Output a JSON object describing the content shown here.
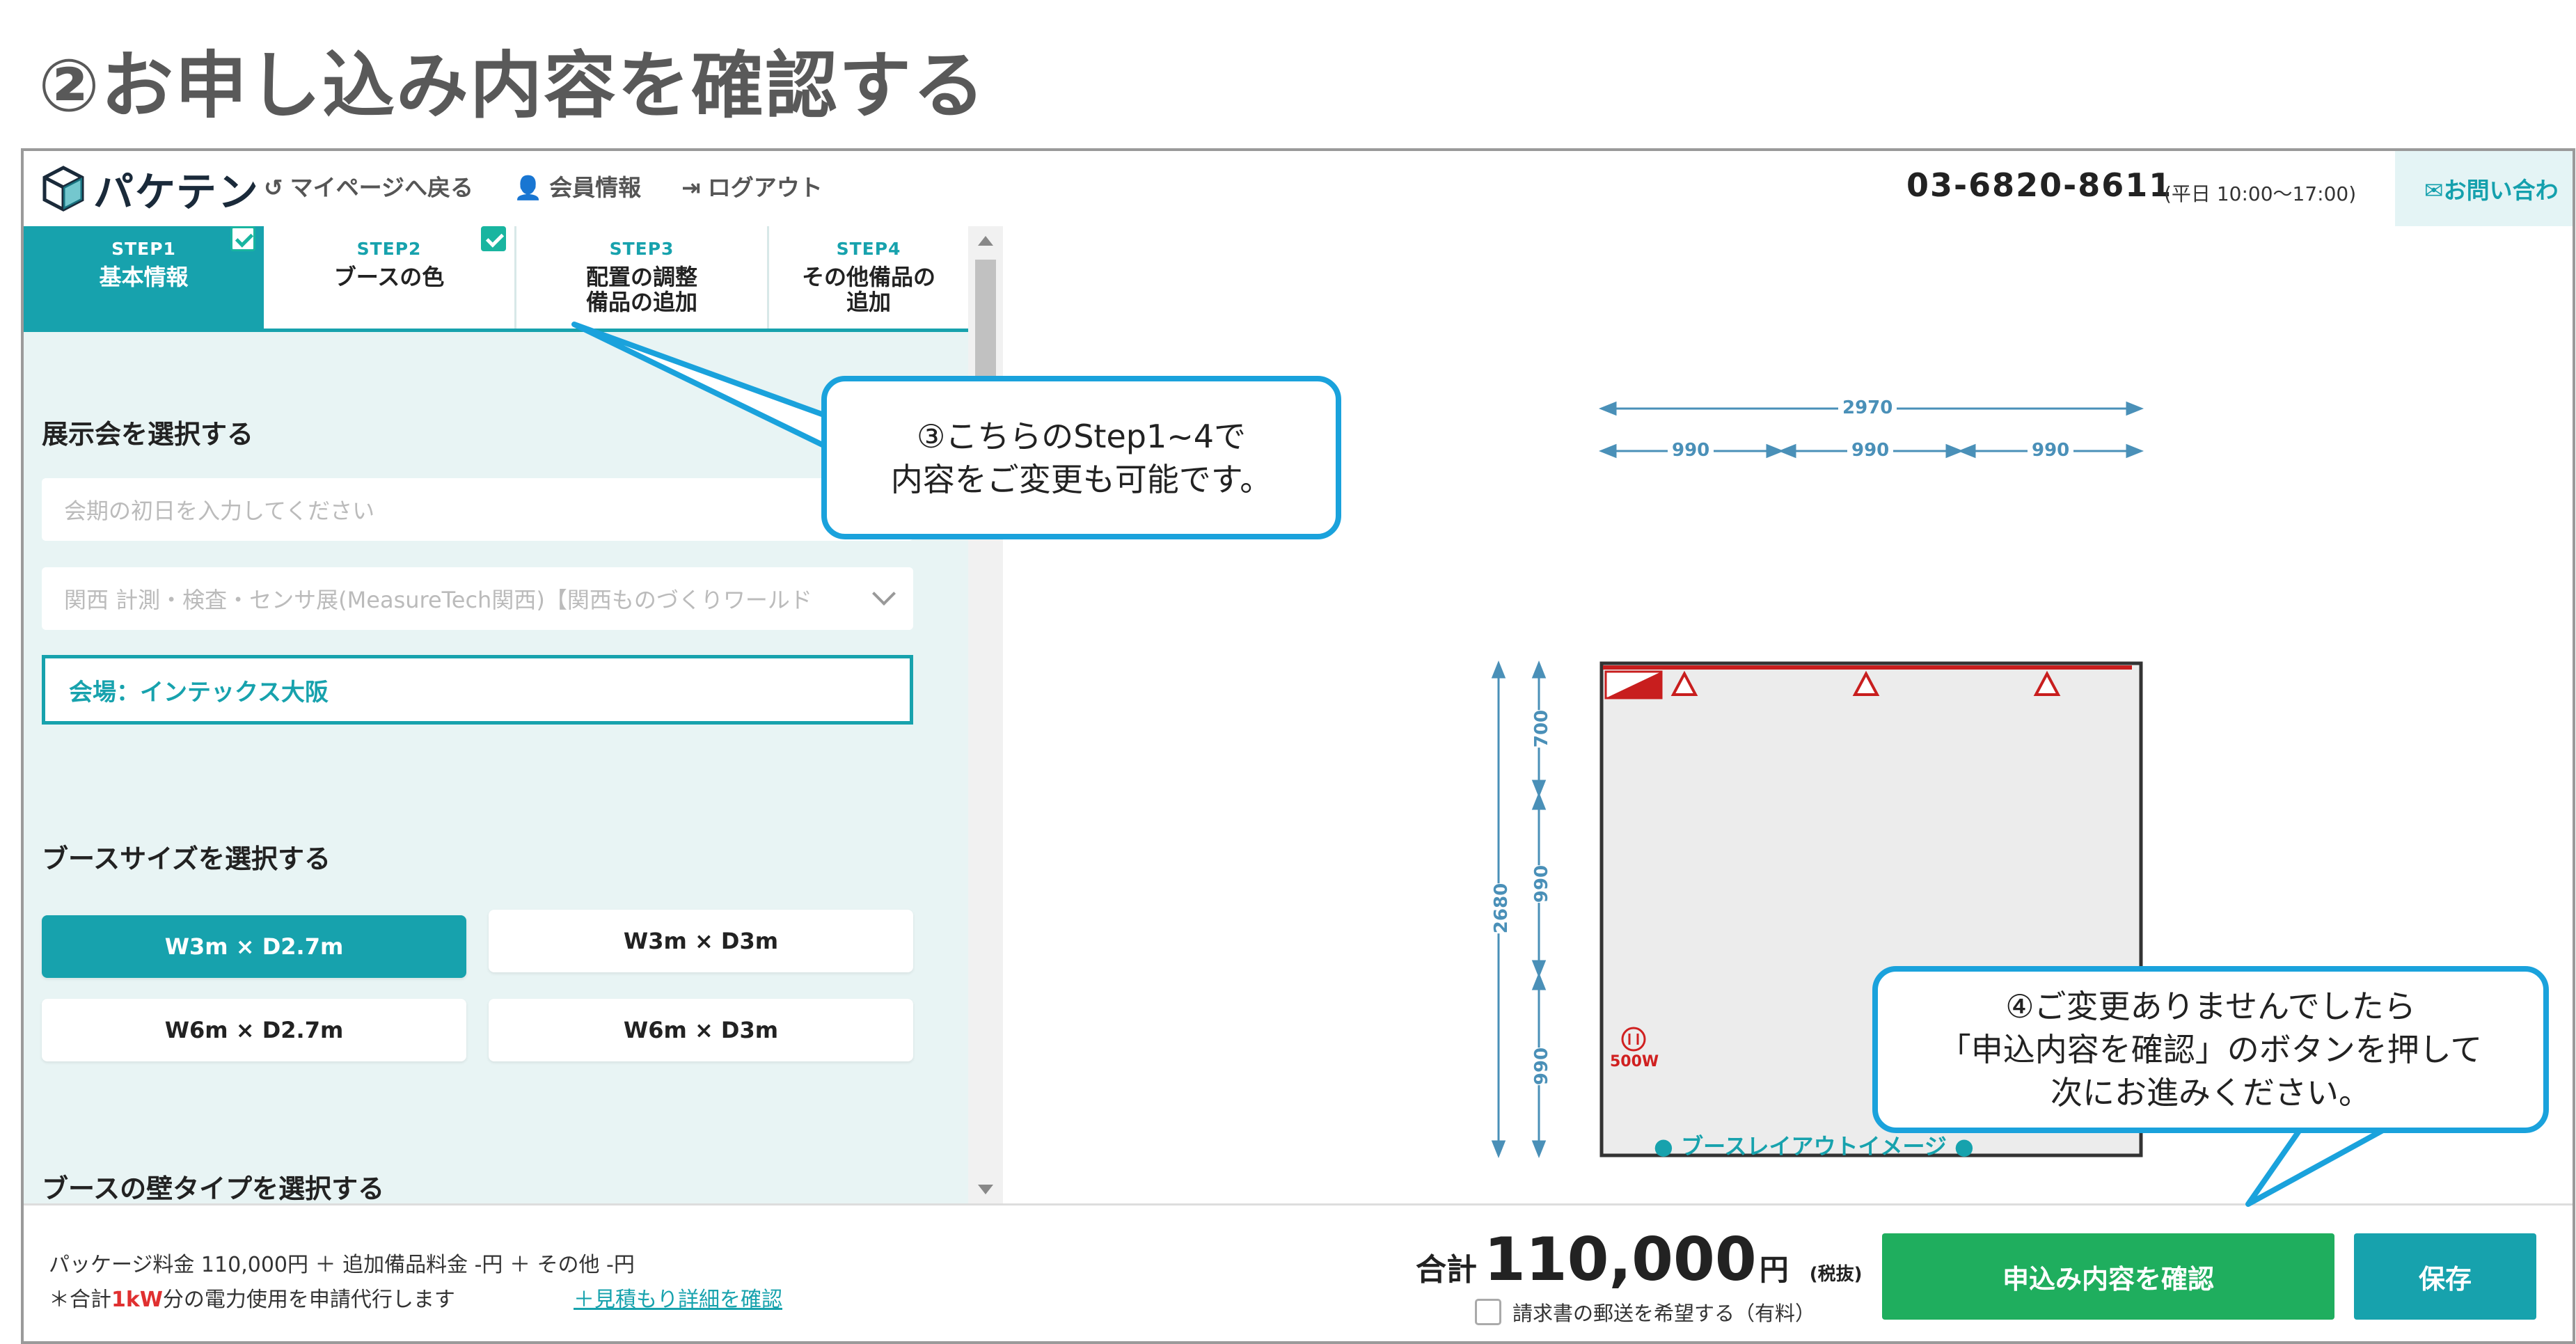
{
  "slide_title": "②お申し込み内容を確認する",
  "header": {
    "logo_text": "パケテン",
    "logo_icon": "box-logo-icon",
    "nav": [
      {
        "icon": "↺",
        "label": "マイページへ戻る"
      },
      {
        "icon": "👤",
        "label": "会員情報"
      },
      {
        "icon": "⇥",
        "label": "ログアウト"
      }
    ],
    "phone": "03-6820-8611",
    "hours": "(平日 10:00～17:00)",
    "contact_label": "✉お問い合わ"
  },
  "steps": [
    {
      "num": "STEP1",
      "label": "基本情報",
      "active": true,
      "checked": true
    },
    {
      "num": "STEP2",
      "label": "ブースの色",
      "active": false,
      "checked": true
    },
    {
      "num": "STEP3",
      "label_line1": "配置の調整",
      "label_line2": "備品の追加",
      "active": false,
      "checked": false
    },
    {
      "num": "STEP4",
      "label_line1": "その他備品の",
      "label_line2": "追加",
      "active": false,
      "checked": false
    }
  ],
  "exhibition": {
    "heading": "展示会を選択する",
    "date_placeholder": "会期の初日を入力してください",
    "selected_exhibition": "関西 計測・検査・センサ展(MeasureTech関西)【関西ものづくりワールド",
    "venue": "会場：インテックス大阪"
  },
  "booth_size": {
    "heading": "ブースサイズを選択する",
    "options": [
      "W3m × D2.7m",
      "W3m × D3m",
      "W6m × D2.7m",
      "W6m × D3m"
    ],
    "selected": "W3m × D2.7m"
  },
  "wall_type": {
    "heading": "ブースの壁タイプを選択する"
  },
  "footer": {
    "price_breakdown": "パッケージ料金 110,000円 ＋ 追加備品料金 -円 ＋ その他 -円",
    "power_note_prefix": "＊合計",
    "power_note_value": "1kW",
    "power_note_suffix": "分の電力使用を申請代行します",
    "estimate_link": "＋見積もり詳細を確認",
    "total_label": "合計",
    "total_value": "110,000",
    "total_unit": "円",
    "tax_note": "(税抜)",
    "mail_option": "請求書の郵送を希望する（有料）",
    "confirm_button": "申込み内容を確認",
    "save_button": "保存"
  },
  "drawing": {
    "width_total": "2970",
    "width_segments": [
      "990",
      "990",
      "990"
    ],
    "depth_total": "2680",
    "depth_segments": [
      "700",
      "990",
      "990"
    ],
    "power_label": "500W",
    "caption": "● ブースレイアウトイメージ ●"
  },
  "callouts": {
    "step_callout_line1": "③こちらのStep1~4で",
    "step_callout_line2": "内容をご変更も可能です。",
    "confirm_callout_line1": "④ご変更ありませんでしたら",
    "confirm_callout_line2": "「申込内容を確認」のボタンを押して",
    "confirm_callout_line3": "次にお進みください。"
  },
  "colors": {
    "teal": "#17a2ad",
    "green": "#1fae5e",
    "callout_border": "#1aa2dc",
    "booth_red": "#c81e1e"
  }
}
